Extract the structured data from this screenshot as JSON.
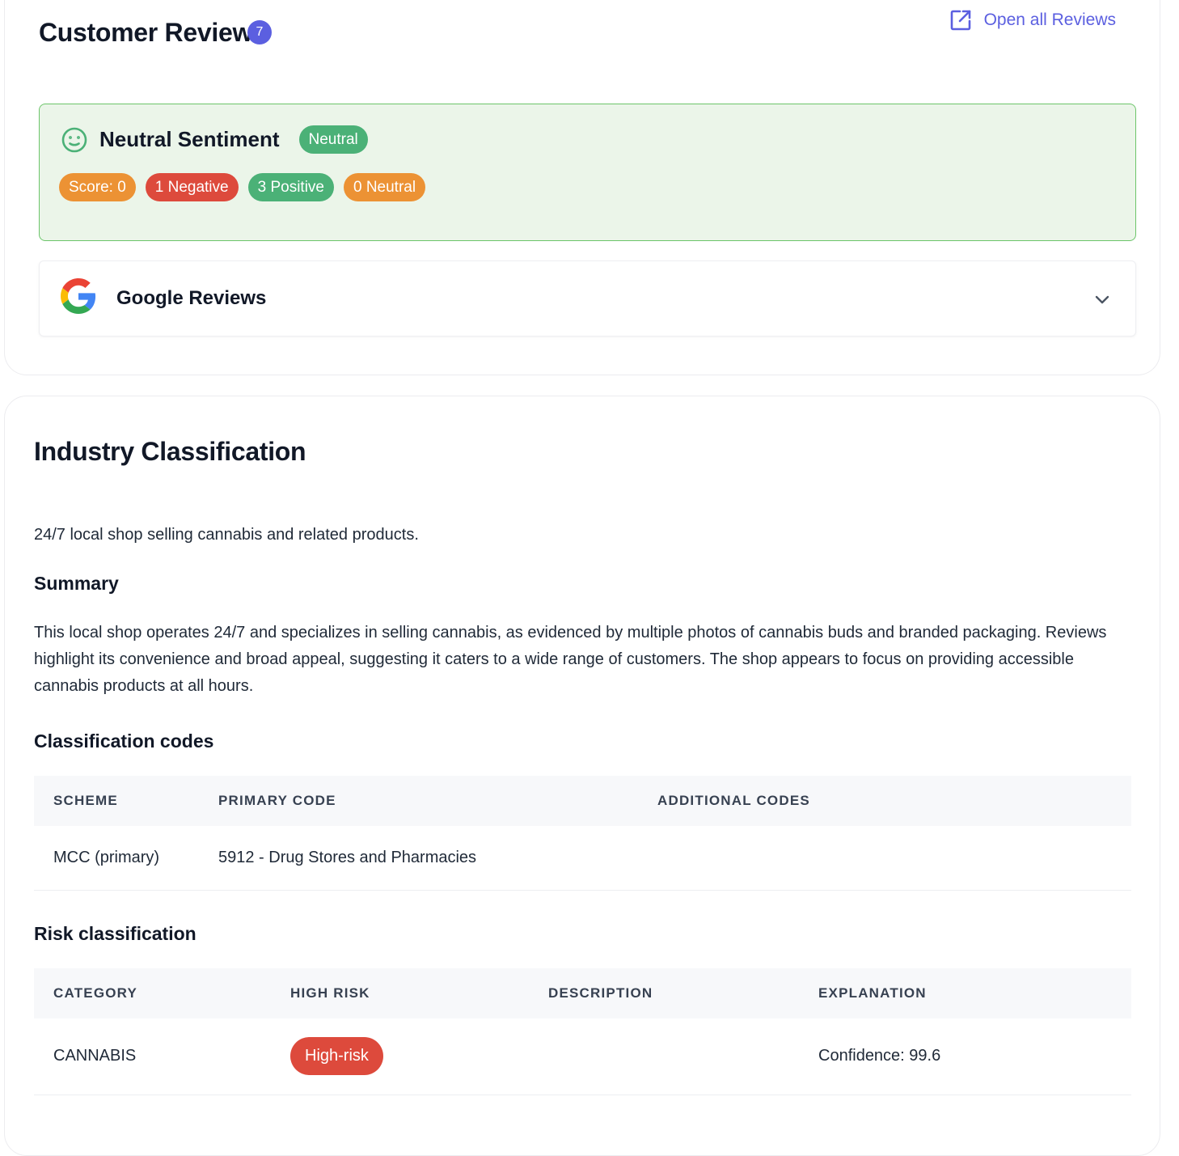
{
  "reviews": {
    "title": "Customer Reviews",
    "count": "7",
    "open_all_label": "Open all Reviews",
    "sentiment": {
      "title": "Neutral Sentiment",
      "badge": "Neutral",
      "pills": {
        "score": "Score: 0",
        "negative": "1 Negative",
        "positive": "3 Positive",
        "neutral": "0 Neutral"
      }
    },
    "google": {
      "title": "Google Reviews",
      "icon": "google-logo-icon"
    }
  },
  "industry": {
    "title": "Industry Classification",
    "description": "24/7 local shop selling cannabis and related products.",
    "summary_heading": "Summary",
    "summary_text": "This local shop operates 24/7 and specializes in selling cannabis, as evidenced by multiple photos of cannabis buds and branded packaging. Reviews highlight its convenience and broad appeal, suggesting it caters to a wide range of customers. The shop appears to focus on providing accessible cannabis products at all hours.",
    "codes_heading": "Classification codes",
    "codes_table": {
      "headers": [
        "SCHEME",
        "PRIMARY CODE",
        "ADDITIONAL CODES"
      ],
      "rows": [
        {
          "scheme": "MCC (primary)",
          "primary": "5912 - Drug Stores and Pharmacies",
          "additional": ""
        }
      ]
    },
    "risk_heading": "Risk classification",
    "risk_table": {
      "headers": [
        "CATEGORY",
        "HIGH RISK",
        "DESCRIPTION",
        "EXPLANATION"
      ],
      "rows": [
        {
          "category": "CANNABIS",
          "high_risk": "High-risk",
          "description": "",
          "explanation": "Confidence: 99.6"
        }
      ]
    }
  },
  "colors": {
    "accent": "#5b5fe0",
    "sentiment_bg": "#ebf5e9",
    "sentiment_border": "#6cc56a",
    "green": "#4bb177",
    "orange": "#ec9234",
    "red": "#dd4a3c"
  }
}
